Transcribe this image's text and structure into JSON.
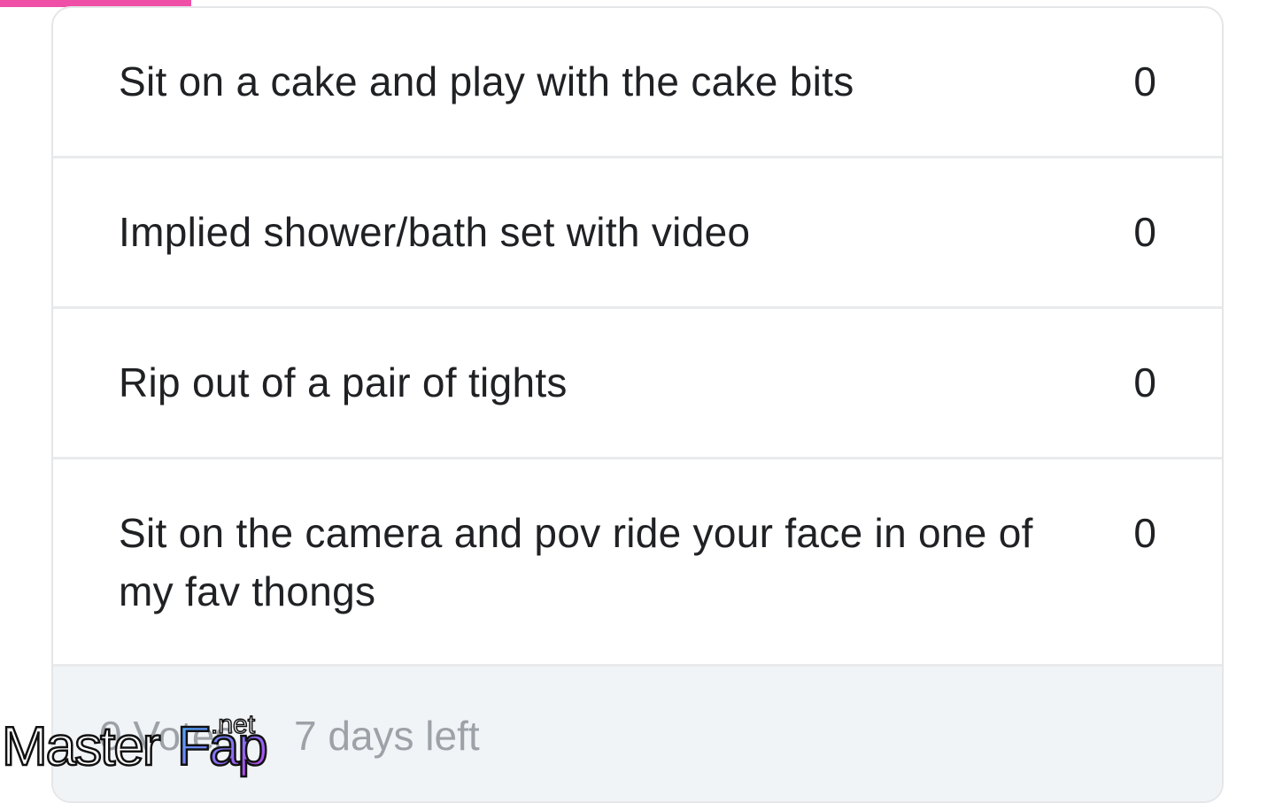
{
  "poll": {
    "options": [
      {
        "label": "Sit on a cake and play with the cake bits",
        "count": "0"
      },
      {
        "label": "Implied shower/bath set with video",
        "count": "0"
      },
      {
        "label": "Rip out of a pair of tights",
        "count": "0"
      },
      {
        "label": "Sit on the camera and pov ride your face in one of my fav thongs",
        "count": "0"
      }
    ],
    "footer": {
      "votes": "0 Votes",
      "time_left": "7 days left"
    }
  },
  "watermark": {
    "brand_master": "Master",
    "brand_fap": "Fap",
    "brand_tld": ".net"
  },
  "colors": {
    "accent": "#ef4fa6",
    "text": "#202124",
    "muted": "#9da2a8",
    "footer_bg": "#f1f4f6"
  }
}
